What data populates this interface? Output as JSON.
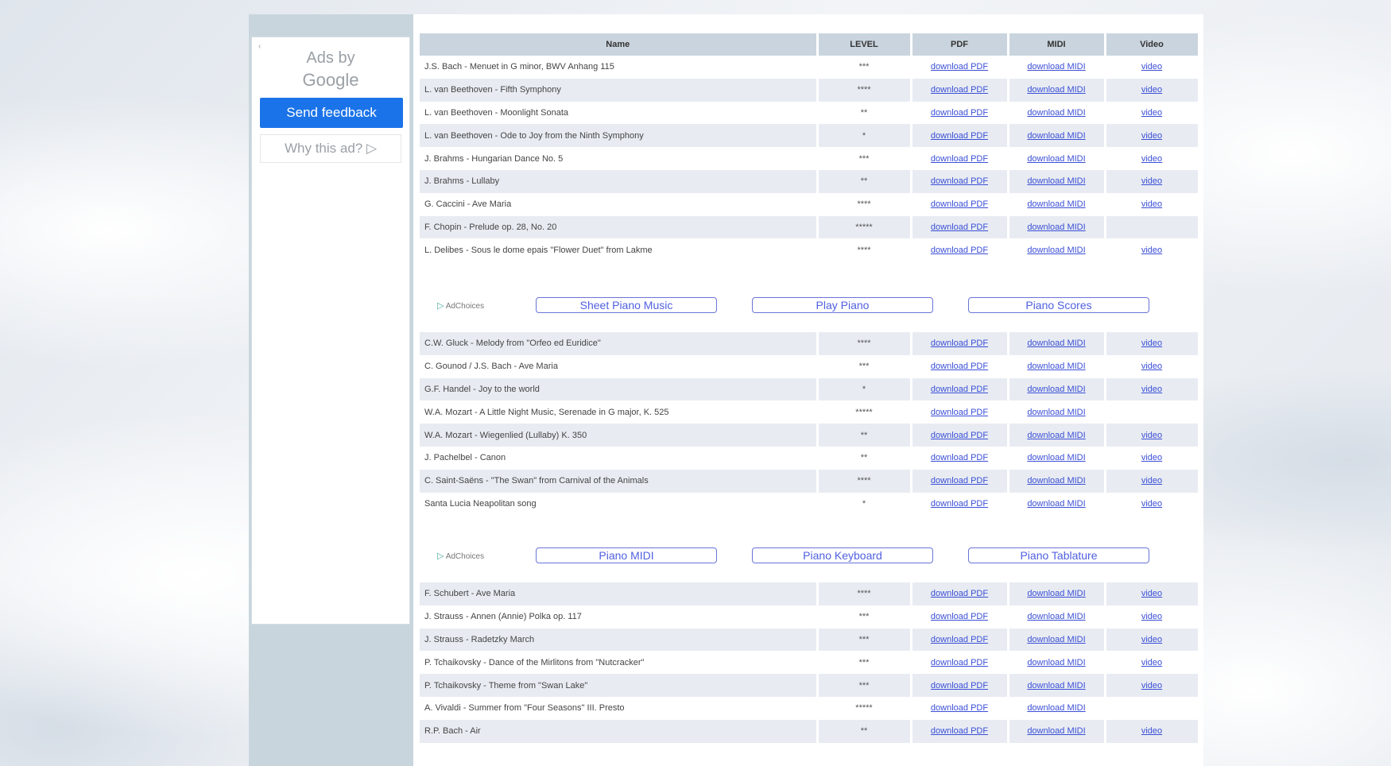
{
  "ad": {
    "ads_by_line1": "Ads by",
    "ads_by_line2": "Google",
    "send_feedback": "Send feedback",
    "why_this_ad": "Why this ad? ▷"
  },
  "table_headers": [
    "Name",
    "LEVEL",
    "PDF",
    "MIDI",
    "Video"
  ],
  "section1": [
    {
      "name": "J.S. Bach - Menuet in G minor, BWV Anhang 115",
      "level": "***",
      "pdf": "download PDF",
      "midi": "download MIDI",
      "video": "video"
    },
    {
      "name": "L. van Beethoven - Fifth Symphony",
      "level": "****",
      "pdf": "download PDF",
      "midi": "download MIDI",
      "video": "video"
    },
    {
      "name": "L. van Beethoven - Moonlight Sonata",
      "level": "**",
      "pdf": "download PDF",
      "midi": "download MIDI",
      "video": "video"
    },
    {
      "name": "L. van Beethoven - Ode to Joy from the Ninth Symphony",
      "level": "*",
      "pdf": "download PDF",
      "midi": "download MIDI",
      "video": "video"
    },
    {
      "name": "J. Brahms - Hungarian Dance No. 5",
      "level": "***",
      "pdf": "download PDF",
      "midi": "download MIDI",
      "video": "video"
    },
    {
      "name": "J. Brahms - Lullaby",
      "level": "**",
      "pdf": "download PDF",
      "midi": "download MIDI",
      "video": "video"
    },
    {
      "name": "G. Caccini - Ave Maria",
      "level": "****",
      "pdf": "download PDF",
      "midi": "download MIDI",
      "video": "video"
    },
    {
      "name": "F. Chopin - Prelude op. 28, No. 20",
      "level": "*****",
      "pdf": "download PDF",
      "midi": "download MIDI",
      "video": ""
    },
    {
      "name": "L. Delibes - Sous le dome epais \"Flower Duet\" from Lakme",
      "level": "****",
      "pdf": "download PDF",
      "midi": "download MIDI",
      "video": "video"
    }
  ],
  "adrow1": {
    "label": "AdChoices",
    "buttons": [
      "Sheet Piano Music",
      "Play Piano",
      "Piano Scores"
    ]
  },
  "section2": [
    {
      "name": "C.W. Gluck - Melody from \"Orfeo ed Euridice\"",
      "level": "****",
      "pdf": "download PDF",
      "midi": "download MIDI",
      "video": "video"
    },
    {
      "name": "C. Gounod / J.S. Bach - Ave Maria",
      "level": "***",
      "pdf": "download PDF",
      "midi": "download MIDI",
      "video": "video"
    },
    {
      "name": "G.F. Handel - Joy to the world",
      "level": "*",
      "pdf": "download PDF",
      "midi": "download MIDI",
      "video": "video"
    },
    {
      "name": "W.A. Mozart - A Little Night Music, Serenade in G major, K. 525",
      "level": "*****",
      "pdf": "download PDF",
      "midi": "download MIDI",
      "video": ""
    },
    {
      "name": "W.A. Mozart - Wiegenlied (Lullaby) K. 350",
      "level": "**",
      "pdf": "download PDF",
      "midi": "download MIDI",
      "video": "video"
    },
    {
      "name": "J. Pachelbel - Canon",
      "level": "**",
      "pdf": "download PDF",
      "midi": "download MIDI",
      "video": "video"
    },
    {
      "name": "C. Saint-Saëns - \"The Swan\" from Carnival of the Animals",
      "level": "****",
      "pdf": "download PDF",
      "midi": "download MIDI",
      "video": "video"
    },
    {
      "name": "Santa Lucia Neapolitan song",
      "level": "*",
      "pdf": "download PDF",
      "midi": "download MIDI",
      "video": "video"
    }
  ],
  "adrow2": {
    "label": "AdChoices",
    "buttons": [
      "Piano MIDI",
      "Piano Keyboard",
      "Piano Tablature"
    ]
  },
  "section3": [
    {
      "name": "F. Schubert - Ave Maria",
      "level": "****",
      "pdf": "download PDF",
      "midi": "download MIDI",
      "video": "video"
    },
    {
      "name": "J. Strauss - Annen (Annie) Polka op. 117",
      "level": "***",
      "pdf": "download PDF",
      "midi": "download MIDI",
      "video": "video"
    },
    {
      "name": "J. Strauss - Radetzky March",
      "level": "***",
      "pdf": "download PDF",
      "midi": "download MIDI",
      "video": "video"
    },
    {
      "name": "P. Tchaikovsky - Dance of the Mirlitons from \"Nutcracker\"",
      "level": "***",
      "pdf": "download PDF",
      "midi": "download MIDI",
      "video": "video"
    },
    {
      "name": "P. Tchaikovsky - Theme from \"Swan Lake\"",
      "level": "***",
      "pdf": "download PDF",
      "midi": "download MIDI",
      "video": "video"
    },
    {
      "name": "A. Vivaldi - Summer from \"Four Seasons\" III. Presto",
      "level": "*****",
      "pdf": "download PDF",
      "midi": "download MIDI",
      "video": ""
    },
    {
      "name": "R.P. Bach - Air",
      "level": "**",
      "pdf": "download PDF",
      "midi": "download MIDI",
      "video": "video"
    }
  ]
}
